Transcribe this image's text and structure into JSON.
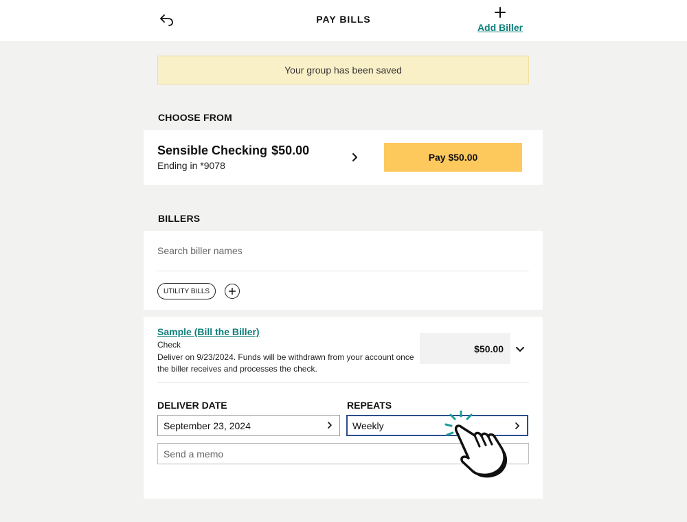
{
  "header": {
    "title": "PAY BILLS",
    "add_biller_label": "Add Biller"
  },
  "banner": {
    "message": "Your group has been saved"
  },
  "choose_from": {
    "section_title": "CHOOSE FROM",
    "account_name": "Sensible Checking",
    "account_balance": "$50.00",
    "account_ending": "Ending in *9078",
    "pay_button_label": "Pay $50.00"
  },
  "billers": {
    "section_title": "BILLERS",
    "search_placeholder": "Search biller names",
    "chip_label": "UTILITY BILLS"
  },
  "biller_detail": {
    "name": "Sample (Bill the Biller)",
    "payment_type": "Check",
    "description": "Deliver on 9/23/2024. Funds will be withdrawn from your account once the biller receives and processes the check.",
    "amount": "$50.00",
    "deliver_date_label": "DELIVER DATE",
    "deliver_date_value": "September 23, 2024",
    "repeats_label": "REPEATS",
    "repeats_value": "Weekly",
    "memo_placeholder": "Send a memo"
  },
  "icons": {
    "back": "back-arrow-icon",
    "add": "plus-icon",
    "chevron": "chevron-right-icon",
    "expand": "chevron-down-icon",
    "cursor": "hand-pointer-icon"
  },
  "colors": {
    "accent_link": "#0e7f7a",
    "pay_button": "#fec95c",
    "banner_bg": "#faf0c8",
    "active_border": "#2a4e8c",
    "page_bg": "#f2f2f0"
  }
}
